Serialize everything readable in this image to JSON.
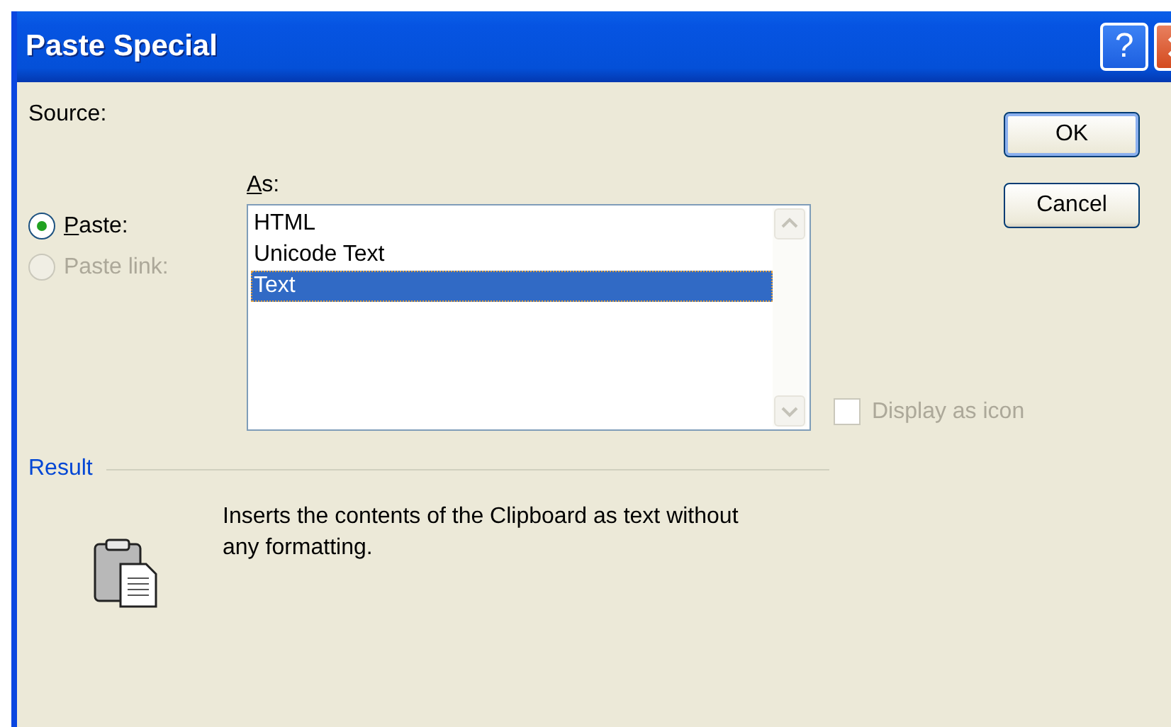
{
  "window": {
    "title": "Paste Special"
  },
  "title_buttons": [
    {
      "kind": "help",
      "label": "?"
    },
    {
      "kind": "close"
    }
  ],
  "source_label": "Source:",
  "paste_options": [
    {
      "label": "Paste:",
      "selected": true,
      "disabled": false,
      "mnemonic": true
    },
    {
      "label": "Paste link:",
      "selected": false,
      "disabled": true,
      "mnemonic": false
    }
  ],
  "as_list": {
    "label": "As:",
    "mnemonic": true,
    "items": [
      {
        "label": "HTML",
        "selected": false
      },
      {
        "label": "Unicode Text",
        "selected": false
      },
      {
        "label": "Text",
        "selected": true
      }
    ]
  },
  "display_as_icon": {
    "label": "Display as icon",
    "checked": false,
    "disabled": true
  },
  "buttons": [
    "OK",
    "Cancel"
  ],
  "result": {
    "label": "Result",
    "description": "Inserts the contents of the Clipboard as text without any formatting."
  }
}
